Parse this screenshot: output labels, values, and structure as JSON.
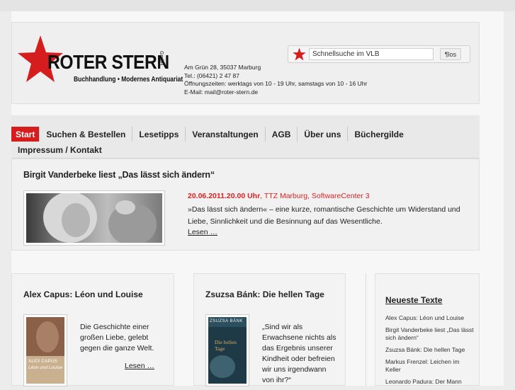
{
  "brand": {
    "name": "ROTER STERN",
    "gmbh": "GmbH",
    "tagline": "Buchhandlung • Modernes Antiquariat",
    "color": "#d51d1d"
  },
  "address": {
    "line1": "Am Grün 28, 35037 Marburg",
    "line2": "Tel.: (06421) 2 47 87",
    "line3": "Öffnungszeiten: werktags von 10 - 19 Uhr, samstags von 10 - 16 Uhr",
    "line4": "E-Mail: mail@roter-stern.de"
  },
  "search": {
    "value": "Schnellsuche im VLB",
    "button": "¶los"
  },
  "nav": {
    "row1": [
      "Start",
      "Suchen & Bestellen",
      "Lesetipps",
      "Veranstaltungen",
      "AGB",
      "Über uns",
      "Büchergilde"
    ],
    "row2": [
      "Impressum / Kontakt"
    ],
    "active": "Start"
  },
  "feature": {
    "title": "Birgit Vanderbeke liest „Das lässt sich ändern“",
    "date": "20.06.2011.20.00 Uhr",
    "location": ", TTZ Marburg, SoftwareCenter 3",
    "description": "»Das lässt sich ändern« – eine kurze, romantische Geschichte um Widerstand und Liebe, Sinnlichkeit und die Besinnung auf das Wesentliche.",
    "more": "Lesen …"
  },
  "cards": [
    {
      "title": "Alex Capus: Léon und Louise",
      "text": "Die Geschichte einer großen Liebe, gelebt gegen die ganze Welt.",
      "more": "Lesen …",
      "cover_author": "ALEX CAPUS",
      "cover_title": "Léon und Louise"
    },
    {
      "title": "Zsuzsa Bánk: Die hellen Tage",
      "text": "„Sind wir als Erwachsene nichts als das Ergebnis unserer Kindheit oder befreien wir uns irgendwann von ihr?“",
      "cover_author": "ZSUZSA BÁNK",
      "cover_title": "Die hellen Tage"
    }
  ],
  "sidebar": {
    "title": "Neueste Texte",
    "items": [
      "Alex Capus: Léon und Louise",
      "Birgit Vanderbeke liest „Das lässt sich ändern“",
      "Zsuzsa Bánk: Die hellen Tage",
      "Markus Frenzel: Leichen im Keller",
      "Leonardo Padura: Der Mann"
    ]
  }
}
